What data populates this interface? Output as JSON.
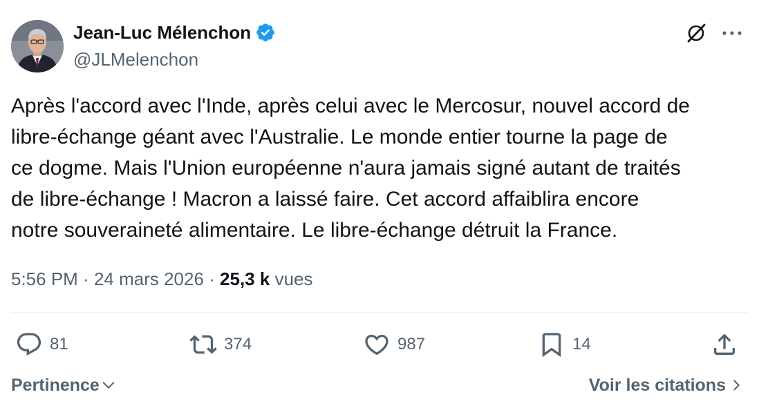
{
  "author": {
    "name": "Jean-Luc Mélenchon",
    "handle": "@JLMelenchon",
    "verified": true
  },
  "tweet": {
    "lines": [
      "Après l'accord avec l'Inde, après celui avec le Mercosur, nouvel accord de",
      "libre-échange géant avec l'Australie. Le monde entier tourne la page de",
      "ce dogme. Mais l'Union européenne n'aura jamais signé autant de traités",
      "de libre-échange ! Macron a laissé faire. Cet accord affaiblira encore",
      "notre souveraineté alimentaire. Le libre-échange détruit la France."
    ]
  },
  "meta": {
    "time": "5:56 PM",
    "separator": " · ",
    "date": "24 mars 2026",
    "views_count": "25,3 k",
    "views_label": "vues"
  },
  "actions": {
    "replies": "81",
    "reposts": "374",
    "likes": "987",
    "bookmarks": "14"
  },
  "footer": {
    "sort_label": "Pertinence",
    "quotes_label": "Voir les citations"
  },
  "icons": {
    "verified": "verified-badge-icon",
    "grok": "grok-icon",
    "more": "more-icon",
    "reply": "reply-icon",
    "repost": "repost-icon",
    "like": "like-icon",
    "bookmark": "bookmark-icon",
    "share": "share-icon"
  },
  "colors": {
    "text": "#0f1419",
    "secondary": "#536471",
    "verified": "#1d9bf0",
    "divider": "#eff3f4"
  }
}
